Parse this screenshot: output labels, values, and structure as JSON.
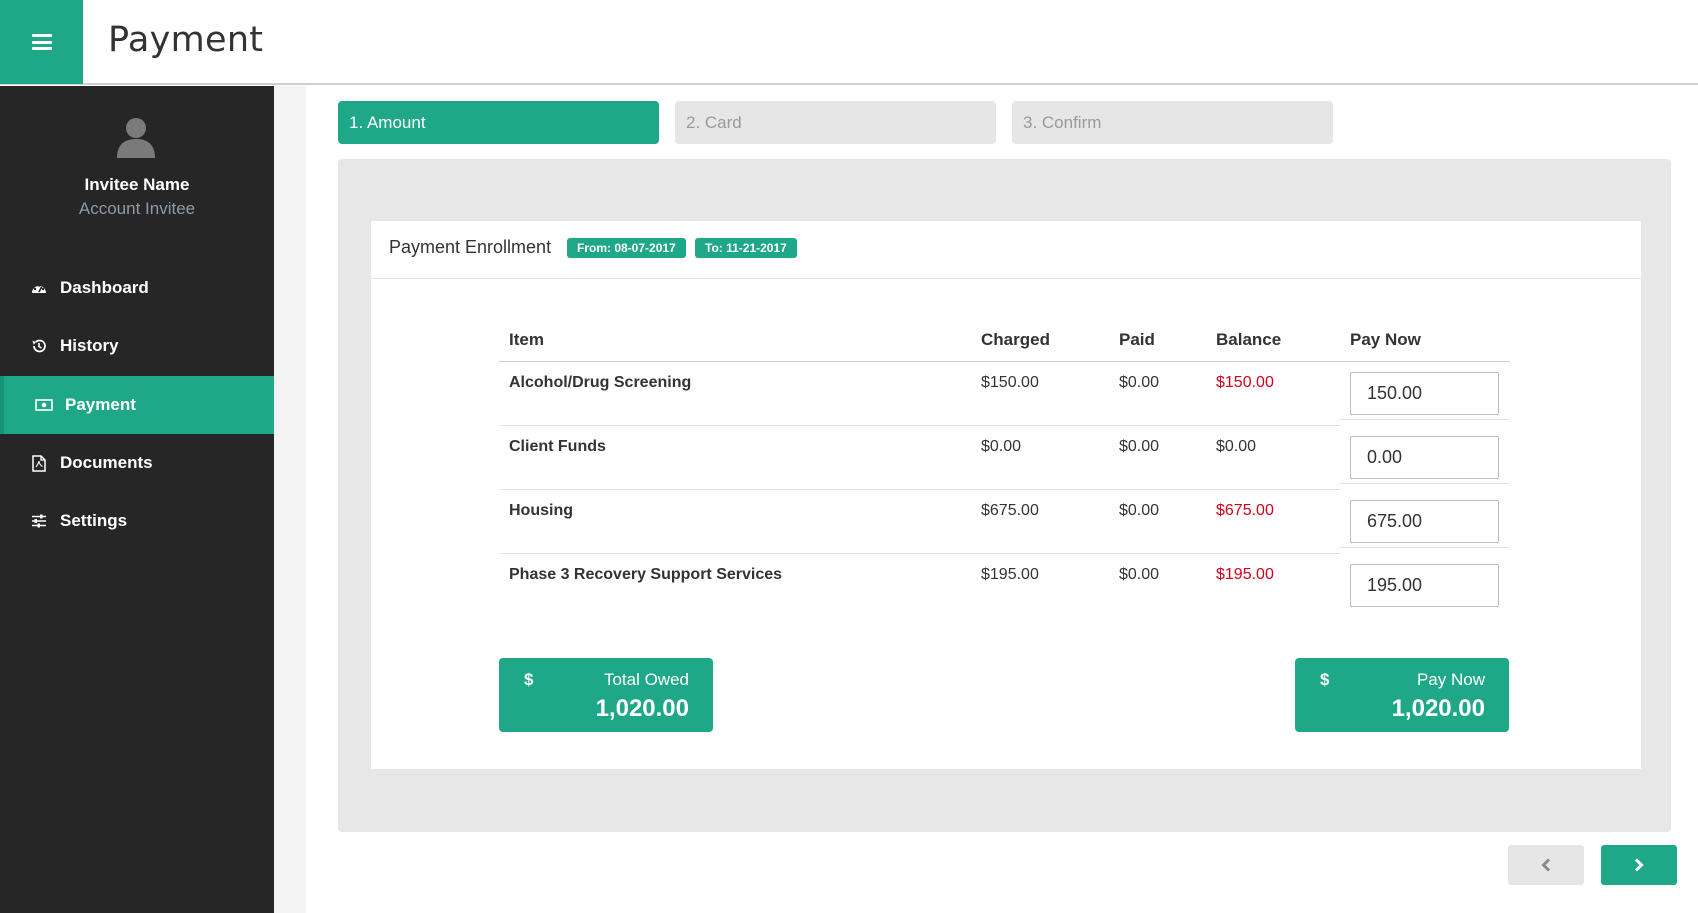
{
  "header": {
    "title": "Payment",
    "menu_icon": "hamburger-icon"
  },
  "user": {
    "name": "Invitee Name",
    "role": "Account Invitee",
    "avatar_icon": "user-silhouette-icon"
  },
  "sidebar": {
    "items": [
      {
        "label": "Dashboard",
        "icon": "dashboard-icon",
        "active": false
      },
      {
        "label": "History",
        "icon": "history-icon",
        "active": false
      },
      {
        "label": "Payment",
        "icon": "money-icon",
        "active": true
      },
      {
        "label": "Documents",
        "icon": "pdf-document-icon",
        "active": false
      },
      {
        "label": "Settings",
        "icon": "sliders-icon",
        "active": false
      }
    ]
  },
  "steps": [
    {
      "label": "1. Amount",
      "active": true
    },
    {
      "label": "2. Card",
      "active": false
    },
    {
      "label": "3. Confirm",
      "active": false
    }
  ],
  "panel": {
    "title": "Payment Enrollment",
    "from_badge": "From: 08-07-2017",
    "to_badge": "To: 11-21-2017"
  },
  "table": {
    "headers": [
      "Item",
      "Charged",
      "Paid",
      "Balance",
      "Pay Now"
    ],
    "rows": [
      {
        "item": "Alcohol/Drug Screening",
        "charged": "$150.00",
        "paid": "$0.00",
        "balance": "$150.00",
        "balance_due": true,
        "pay_now": "150.00"
      },
      {
        "item": "Client Funds",
        "charged": "$0.00",
        "paid": "$0.00",
        "balance": "$0.00",
        "balance_due": false,
        "pay_now": "0.00"
      },
      {
        "item": "Housing",
        "charged": "$675.00",
        "paid": "$0.00",
        "balance": "$675.00",
        "balance_due": true,
        "pay_now": "675.00"
      },
      {
        "item": "Phase 3 Recovery Support Services",
        "charged": "$195.00",
        "paid": "$0.00",
        "balance": "$195.00",
        "balance_due": true,
        "pay_now": "195.00"
      }
    ]
  },
  "totals": {
    "owed": {
      "symbol": "$",
      "label": "Total Owed",
      "amount": "1,020.00"
    },
    "pay_now": {
      "symbol": "$",
      "label": "Pay Now",
      "amount": "1,020.00"
    }
  },
  "pager": {
    "prev_icon": "chevron-left-icon",
    "next_icon": "chevron-right-icon"
  },
  "colors": {
    "accent": "#1fa888",
    "sidebar_bg": "#262626",
    "balance_red": "#d0021b",
    "muted_text": "#8e9aa9"
  }
}
